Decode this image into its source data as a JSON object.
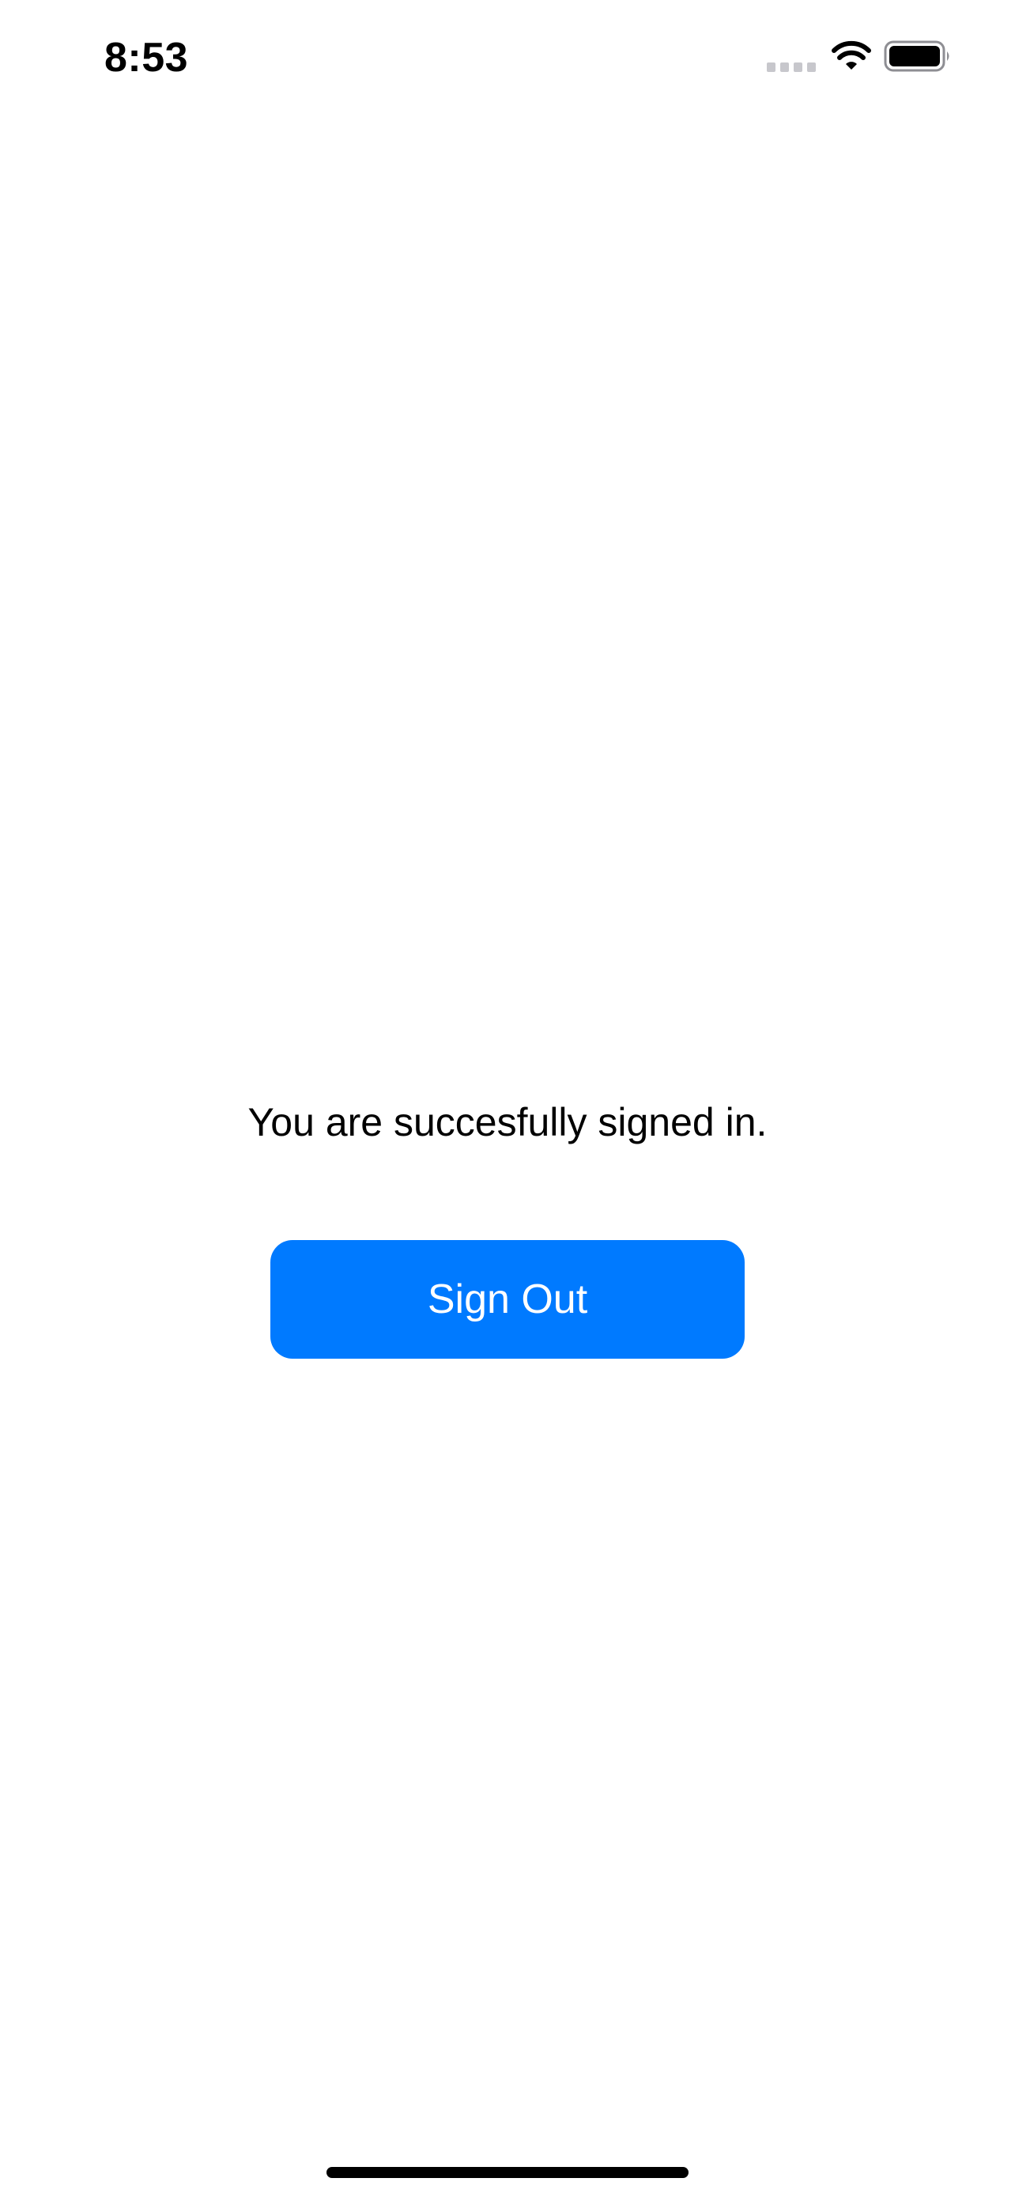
{
  "status_bar": {
    "time": "8:53",
    "icons": [
      "signal-icon",
      "wifi-icon",
      "battery-icon"
    ]
  },
  "main": {
    "message": "You are succesfully signed in.",
    "sign_out_label": "Sign Out"
  },
  "colors": {
    "accent": "#007AFF",
    "background": "#FFFFFF",
    "text": "#000000",
    "button_text": "#FFFFFF",
    "signal_inactive": "#C7C7CC"
  }
}
